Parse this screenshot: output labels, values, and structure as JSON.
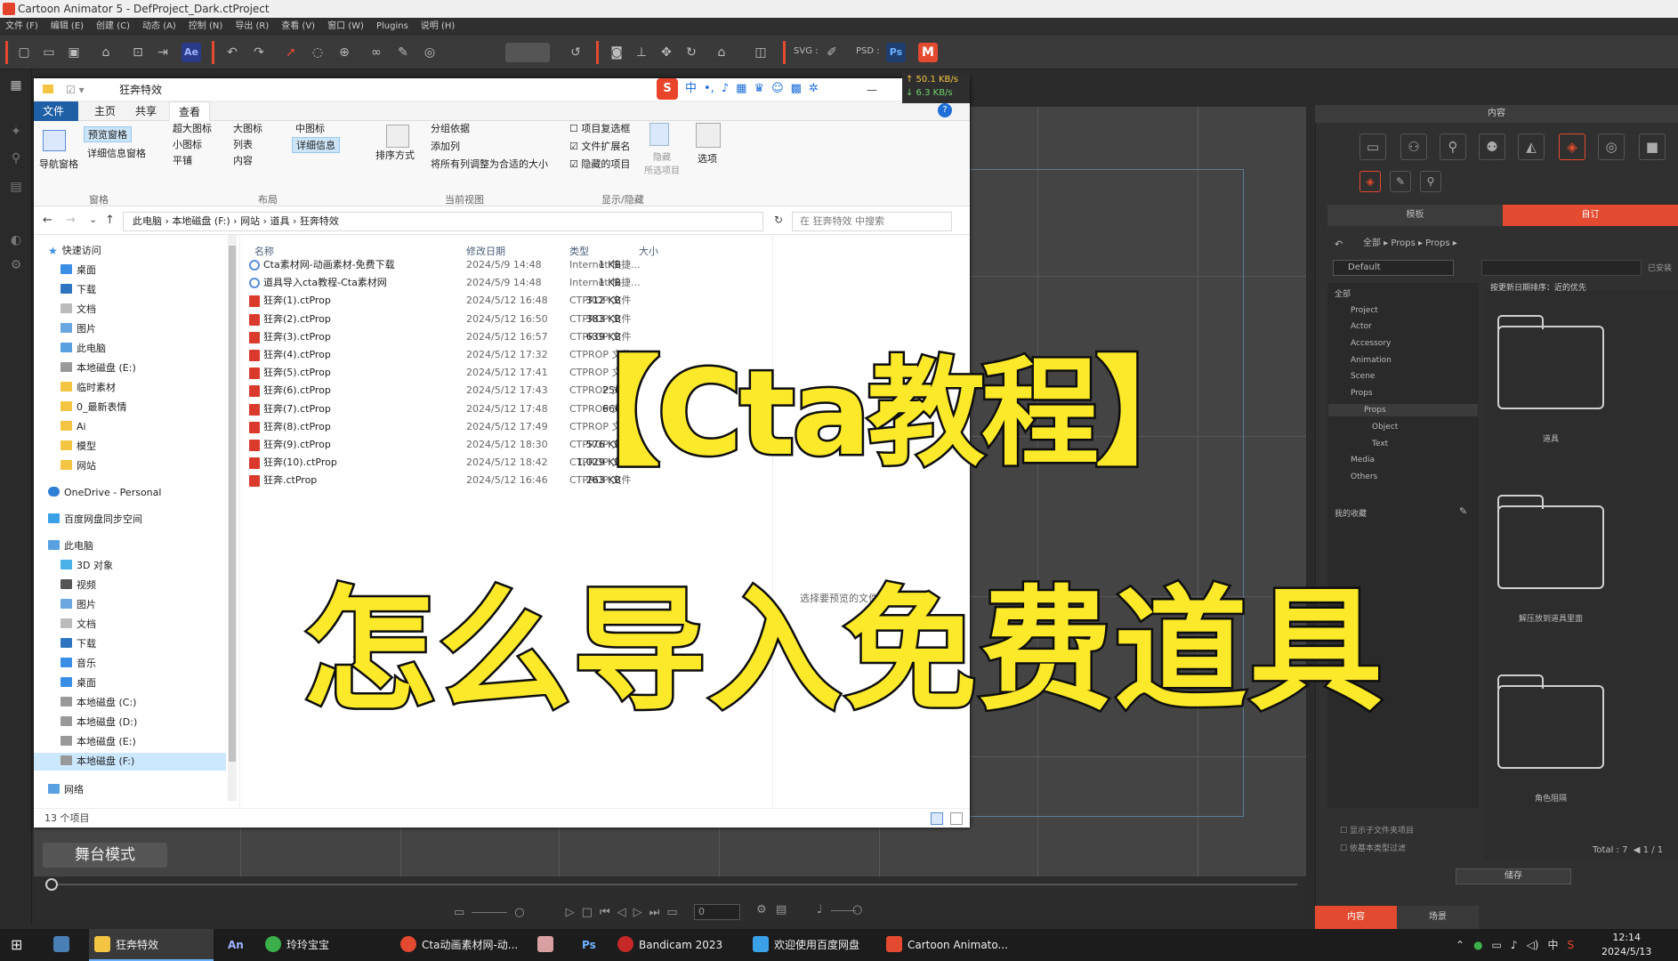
{
  "app": {
    "title": "Cartoon Animator 5 - DefProject_Dark.ctProject"
  },
  "menu": [
    "文件 (F)",
    "编辑 (E)",
    "创建 (C)",
    "动态 (A)",
    "控制 (N)",
    "导出 (R)",
    "查看 (V)",
    "窗口 (W)",
    "Plugins",
    "说明 (H)"
  ],
  "toolbar": {
    "svg_label": "SVG :",
    "psd_label": "PSD :",
    "ae_label": "Ae",
    "ps_label": "Ps",
    "m_label": "M"
  },
  "stage": {
    "mode_label": "舞台模式",
    "frame_value": "0"
  },
  "explorer": {
    "title": "狂奔特效",
    "net_up": "↑ 50.1 KB/s",
    "net_down": "↓ 6.3 KB/s",
    "ime_items": [
      "中",
      "•,",
      "♪"
    ],
    "ribbon_tabs": [
      "文件",
      "主页",
      "共享",
      "查看"
    ],
    "ribbon": {
      "nav_pane": "导航窗格",
      "preview_pane": "预览窗格",
      "details_pane": "详细信息窗格",
      "layout_items": [
        "超大图标",
        "大图标",
        "中图标",
        "小图标",
        "列表",
        "详细信息",
        "平铺",
        "内容"
      ],
      "sort": "排序方式",
      "group_by": "分组依据",
      "add_column": "添加列",
      "fit_columns": "将所有列调整为合适的大小",
      "item_checkbox": "项目复选框",
      "file_ext": "文件扩展名",
      "hidden_items": "隐藏的项目",
      "hide_selected": "隐藏\n所选项目",
      "options": "选项",
      "groups": [
        "窗格",
        "布局",
        "当前视图",
        "显示/隐藏"
      ]
    },
    "path": [
      "此电脑",
      "本地磁盘 (F:)",
      "网站",
      "道具",
      "狂奔特效"
    ],
    "search_placeholder": "在 狂奔特效 中搜索",
    "nav": [
      "快速访问",
      "桌面",
      "下载",
      "文档",
      "图片",
      "此电脑",
      "本地磁盘 (E:)",
      "临时素材",
      "0_最新表情",
      "Ai",
      "模型",
      "网站",
      "OneDrive - Personal",
      "百度网盘同步空间",
      "此电脑",
      "3D 对象",
      "视频",
      "图片",
      "文档",
      "下载",
      "音乐",
      "桌面",
      "本地磁盘 (C:)",
      "本地磁盘 (D:)",
      "本地磁盘 (E:)",
      "本地磁盘 (F:)",
      "网络"
    ],
    "columns": [
      "名称",
      "修改日期",
      "类型",
      "大小"
    ],
    "files": [
      {
        "name": "Cta素材网-动画素材-免费下载",
        "date": "2024/5/9 14:48",
        "type": "Internet 快捷...",
        "size": "1 KB",
        "kind": "web"
      },
      {
        "name": "道具导入cta教程-Cta素材网",
        "date": "2024/5/9 14:48",
        "type": "Internet 快捷...",
        "size": "1 KB",
        "kind": "web"
      },
      {
        "name": "狂奔(1).ctProp",
        "date": "2024/5/12 16:48",
        "type": "CTPROP 文件",
        "size": "312 KB",
        "kind": "prop"
      },
      {
        "name": "狂奔(2).ctProp",
        "date": "2024/5/12 16:50",
        "type": "CTPROP 文件",
        "size": "383 KB",
        "kind": "prop"
      },
      {
        "name": "狂奔(3).ctProp",
        "date": "2024/5/12 16:57",
        "type": "CTPROP 文件",
        "size": "639 KB",
        "kind": "prop"
      },
      {
        "name": "狂奔(4).ctProp",
        "date": "2024/5/12 17:32",
        "type": "CTPROP 文件",
        "size": "",
        "kind": "prop"
      },
      {
        "name": "狂奔(5).ctProp",
        "date": "2024/5/12 17:41",
        "type": "CTPROP 文件",
        "size": "",
        "kind": "prop"
      },
      {
        "name": "狂奔(6).ctProp",
        "date": "2024/5/12 17:43",
        "type": "CTPROP 文件",
        "size": "256",
        "kind": "prop"
      },
      {
        "name": "狂奔(7).ctProp",
        "date": "2024/5/12 17:48",
        "type": "CTPROP 文件",
        "size": "666",
        "kind": "prop"
      },
      {
        "name": "狂奔(8).ctProp",
        "date": "2024/5/12 17:49",
        "type": "CTPROP 文件",
        "size": "",
        "kind": "prop"
      },
      {
        "name": "狂奔(9).ctProp",
        "date": "2024/5/12 18:30",
        "type": "CTPROP 文件",
        "size": "576 KB",
        "kind": "prop"
      },
      {
        "name": "狂奔(10).ctProp",
        "date": "2024/5/12 18:42",
        "type": "CTPROP 文件",
        "size": "1,029 KB",
        "kind": "prop"
      },
      {
        "name": "狂奔.ctProp",
        "date": "2024/5/12 16:46",
        "type": "CTPROP 文件",
        "size": "263 KB",
        "kind": "prop"
      }
    ],
    "preview_text": "选择要预览的文件。",
    "status": "13 个项目"
  },
  "overlay": {
    "title_line": "【Cta教程】",
    "subtitle_line": "怎么导入免费道具"
  },
  "right_panel": {
    "title": "内容",
    "tabs": [
      "模板",
      "自订"
    ],
    "path": "全部 ▸ Props ▸ Props ▸",
    "preset": "Default",
    "installed": "已安装",
    "tree": [
      "全部",
      "Project",
      "Actor",
      "Accessory",
      "Animation",
      "Scene",
      "Props",
      "Props",
      "Object",
      "Text",
      "Media",
      "Others"
    ],
    "favorites": "我的收藏",
    "sort_label": "按更新日期排序：近的优先",
    "folders": [
      "道具",
      "解压放到道具里面",
      "角色阻隔"
    ],
    "check1": "显示子文件夹项目",
    "check2": "依基本类型过滤",
    "total": "Total : 7",
    "page": "1 / 1",
    "save_btn": "储存",
    "bottom_tabs": [
      "内容",
      "场景"
    ]
  },
  "taskbar": {
    "items": [
      "狂奔特效",
      "An",
      "玲玲宝宝",
      "Cta动画素材网-动...",
      "Ps",
      "Bandicam 2023",
      "欢迎使用百度网盘",
      "Cartoon Animato..."
    ],
    "ime": "中",
    "time": "12:14",
    "date": "2024/5/13"
  },
  "colors": {
    "accent": "#e34a2f",
    "caption": "#fbe92a",
    "explorer_tab": "#1f5fa5"
  }
}
